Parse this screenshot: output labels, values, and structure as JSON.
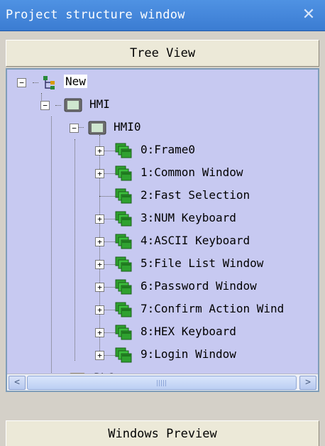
{
  "window": {
    "title": "Project structure window",
    "close_symbol": "✕"
  },
  "tree_view_label": "Tree View",
  "windows_preview_label": "Windows Preview",
  "tree": {
    "root": {
      "label": "New",
      "icon": "tree-structure-icon",
      "expander": "−"
    },
    "hmi": {
      "label": "HMI",
      "icon": "hmi-device-icon",
      "expander": "−"
    },
    "hmi0": {
      "label": "HMI0",
      "icon": "hmi-device-icon",
      "expander": "−"
    },
    "windows": [
      {
        "label": "0:Frame0",
        "expander": "+"
      },
      {
        "label": "1:Common Window",
        "expander": "+"
      },
      {
        "label": "2:Fast Selection",
        "expander": ""
      },
      {
        "label": "3:NUM Keyboard",
        "expander": "+"
      },
      {
        "label": "4:ASCII Keyboard",
        "expander": "+"
      },
      {
        "label": "5:File List Window",
        "expander": "+"
      },
      {
        "label": "6:Password Window",
        "expander": "+"
      },
      {
        "label": "7:Confirm Action Wind",
        "expander": "+"
      },
      {
        "label": "8:HEX Keyboard",
        "expander": "+"
      },
      {
        "label": "9:Login Window",
        "expander": "+"
      }
    ],
    "plc": {
      "label": "PLC",
      "icon": "plc-chip-icon"
    }
  },
  "scrollbar": {
    "left_arrow": "<",
    "right_arrow": ">"
  },
  "colors": {
    "title_bar": "#3b7cd2",
    "tree_background": "#c7c9f1",
    "window_icon_green": "#2fa12f",
    "plc_icon": "#d9a400"
  }
}
